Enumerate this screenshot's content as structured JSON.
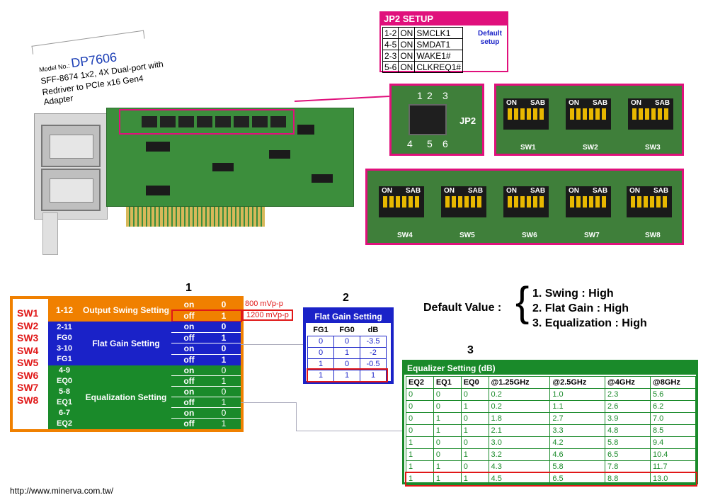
{
  "model": {
    "prefix": "Model No.:",
    "number": "DP7606",
    "desc1": "SFF-8674 1x2, 4X Dual-port with",
    "desc2": "Redriver to PCIe x16 Gen4 Adapter"
  },
  "jp2": {
    "title": "JP2 SETUP",
    "rows": [
      [
        "1-2",
        "ON",
        "SMCLK1"
      ],
      [
        "4-5",
        "ON",
        "SMDAT1"
      ],
      [
        "2-3",
        "ON",
        "WAKE1#"
      ],
      [
        "5-6",
        "ON",
        "CLKREQ1#"
      ]
    ],
    "default": "Default setup"
  },
  "photo_labels": {
    "jp2_pins": [
      "1",
      "2",
      "3",
      "4",
      "5",
      "6"
    ],
    "jp2_label": "JP2",
    "dip_on": "ON",
    "dip_sab": "SAB",
    "switches_top": [
      "SW1",
      "SW2",
      "SW3"
    ],
    "switches_bottom": [
      "SW4",
      "SW5",
      "SW6",
      "SW7",
      "SW8"
    ]
  },
  "table1": {
    "number": "1",
    "switches": [
      "SW1",
      "SW2",
      "SW3",
      "SW4",
      "SW5",
      "SW6",
      "SW7",
      "SW8"
    ],
    "out_pin": "1-12",
    "out_label": "Output Swing Setting",
    "out_rows": [
      [
        "on",
        "0"
      ],
      [
        "off",
        "1"
      ]
    ],
    "out_notes": [
      "800 mVp-p",
      "1200 mVp-p"
    ],
    "fg_pins": [
      [
        "2-11",
        "FG0"
      ],
      [
        "3-10",
        "FG1"
      ]
    ],
    "fg_label": "Flat Gain Setting",
    "fg_rows": [
      [
        "on",
        "0"
      ],
      [
        "off",
        "1"
      ],
      [
        "on",
        "0"
      ],
      [
        "off",
        "1"
      ]
    ],
    "eq_pins": [
      [
        "4-9",
        "EQ0"
      ],
      [
        "5-8",
        "EQ1"
      ],
      [
        "6-7",
        "EQ2"
      ]
    ],
    "eq_label": "Equalization Setting",
    "eq_rows": [
      [
        "on",
        "0"
      ],
      [
        "off",
        "1"
      ],
      [
        "on",
        "0"
      ],
      [
        "off",
        "1"
      ],
      [
        "on",
        "0"
      ],
      [
        "off",
        "1"
      ]
    ]
  },
  "table2": {
    "number": "2",
    "title": "Flat Gain Setting",
    "headers": [
      "FG1",
      "FG0",
      "dB"
    ],
    "rows": [
      [
        "0",
        "0",
        "-3.5"
      ],
      [
        "0",
        "1",
        "-2"
      ],
      [
        "1",
        "0",
        "-0.5"
      ],
      [
        "1",
        "1",
        "1"
      ]
    ]
  },
  "default_value": {
    "label": "Default Value :",
    "items": [
      "1. Swing : High",
      "2. Flat Gain : High",
      "3. Equalization : High"
    ]
  },
  "table3": {
    "number": "3",
    "title": "Equalizer Setting (dB)",
    "headers": [
      "EQ2",
      "EQ1",
      "EQ0",
      "@1.25GHz",
      "@2.5GHz",
      "@4GHz",
      "@8GHz"
    ],
    "rows": [
      [
        "0",
        "0",
        "0",
        "0.2",
        "1.0",
        "2.3",
        "5.6"
      ],
      [
        "0",
        "0",
        "1",
        "0.2",
        "1.1",
        "2.6",
        "6.2"
      ],
      [
        "0",
        "1",
        "0",
        "1.8",
        "2.7",
        "3.9",
        "7.0"
      ],
      [
        "0",
        "1",
        "1",
        "2.1",
        "3.3",
        "4.8",
        "8.5"
      ],
      [
        "1",
        "0",
        "0",
        "3.0",
        "4.2",
        "5.8",
        "9.4"
      ],
      [
        "1",
        "0",
        "1",
        "3.2",
        "4.6",
        "6.5",
        "10.4"
      ],
      [
        "1",
        "1",
        "0",
        "4.3",
        "5.8",
        "7.8",
        "11.7"
      ],
      [
        "1",
        "1",
        "1",
        "4.5",
        "6.5",
        "8.8",
        "13.0"
      ]
    ]
  },
  "url": "http://www.minerva.com.tw/",
  "colors": {
    "magenta": "#e0107c",
    "orange": "#f08000",
    "blue": "#1a22c8",
    "green": "#1a8a2a",
    "red": "#e01818"
  }
}
